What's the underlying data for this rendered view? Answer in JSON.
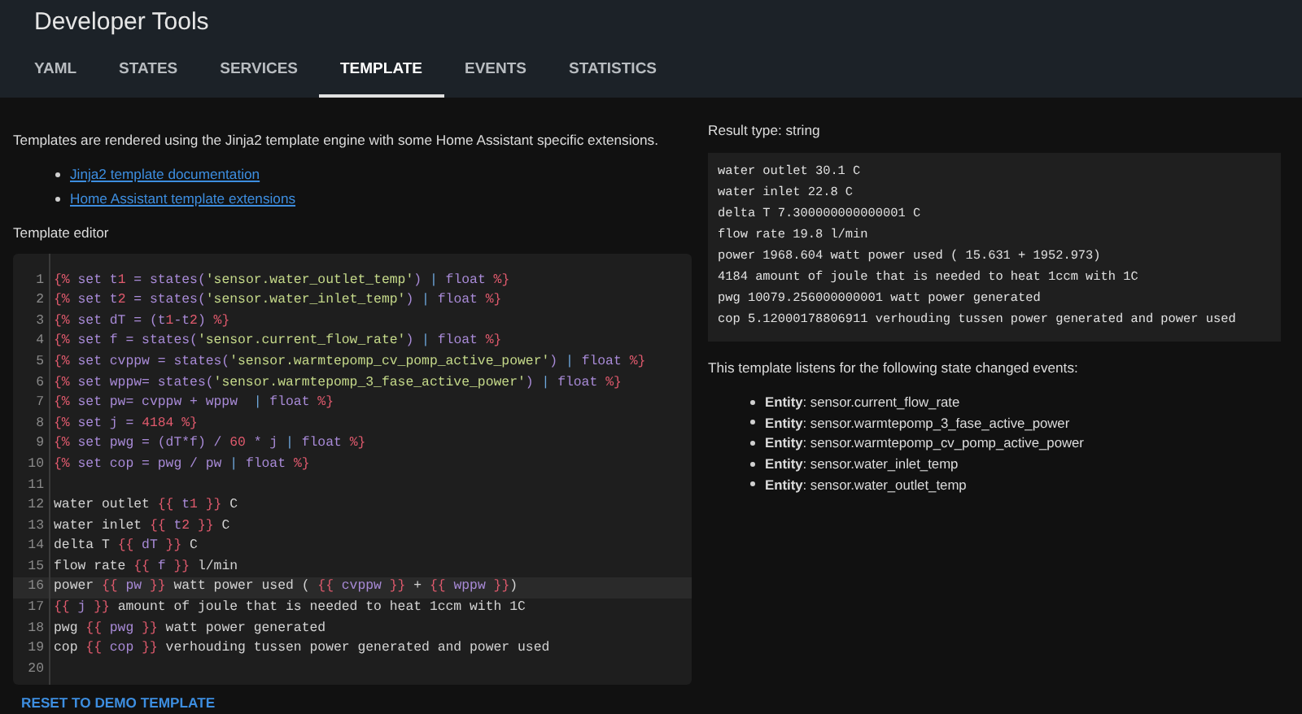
{
  "header": {
    "title": "Developer Tools"
  },
  "tabs": [
    {
      "label": "YAML",
      "selected": false
    },
    {
      "label": "STATES",
      "selected": false
    },
    {
      "label": "SERVICES",
      "selected": false
    },
    {
      "label": "TEMPLATE",
      "selected": true
    },
    {
      "label": "EVENTS",
      "selected": false
    },
    {
      "label": "STATISTICS",
      "selected": false
    }
  ],
  "intro": "Templates are rendered using the Jinja2 template engine with some Home Assistant specific extensions.",
  "links": [
    "Jinja2 template documentation",
    "Home Assistant template extensions"
  ],
  "editor": {
    "title": "Template editor",
    "lines": [
      {
        "number": "1",
        "text": "{% set t1 = states('sensor.water_outlet_temp') | float %}",
        "active": false
      },
      {
        "number": "2",
        "text": "{% set t2 = states('sensor.water_inlet_temp') | float %}",
        "active": false
      },
      {
        "number": "3",
        "text": "{% set dT = (t1-t2) %}",
        "active": false
      },
      {
        "number": "4",
        "text": "{% set f = states('sensor.current_flow_rate') | float %}",
        "active": false
      },
      {
        "number": "5",
        "text": "{% set cvppw = states('sensor.warmtepomp_cv_pomp_active_power') | float %}",
        "active": false
      },
      {
        "number": "6",
        "text": "{% set wppw= states('sensor.warmtepomp_3_fase_active_power') | float %}",
        "active": false
      },
      {
        "number": "7",
        "text": "{% set pw= cvppw + wppw  | float %}",
        "active": false
      },
      {
        "number": "8",
        "text": "{% set j = 4184 %}",
        "active": false
      },
      {
        "number": "9",
        "text": "{% set pwg = (dT*f) / 60 * j | float %}",
        "active": false
      },
      {
        "number": "10",
        "text": "{% set cop = pwg / pw | float %}",
        "active": false
      },
      {
        "number": "11",
        "active": false
      },
      {
        "number": "12",
        "text": "water outlet {{ t1 }} C",
        "active": false
      },
      {
        "number": "13",
        "text": "water inlet {{ t2 }} C",
        "active": false
      },
      {
        "number": "14",
        "text": "delta T {{ dT }} C",
        "active": false
      },
      {
        "number": "15",
        "text": "flow rate {{ f }} l/min",
        "active": false
      },
      {
        "number": "16",
        "text": "power {{ pw }} watt power used ( {{ cvppw }} + {{ wppw }})",
        "active": true
      },
      {
        "number": "17",
        "text": "{{ j }} amount of joule that is needed to heat 1ccm with 1C",
        "active": false
      },
      {
        "number": "18",
        "text": "pwg {{ pwg }} watt power generated",
        "active": false
      },
      {
        "number": "19",
        "text": "cop {{ cop }} verhouding tussen power generated and power used",
        "active": false
      },
      {
        "number": "20",
        "active": false
      }
    ]
  },
  "reset_button": "RESET TO DEMO TEMPLATE",
  "result": {
    "type_label": "Result type: string",
    "lines": [
      "water outlet 30.1 C",
      "water inlet 22.8 C",
      "delta T 7.300000000000001 C",
      "flow rate 19.8 l/min",
      "power 1968.604 watt power used ( 15.631 + 1952.973)",
      "4184 amount of joule that is needed to heat 1ccm with 1C",
      "pwg 10079.256000000001 watt power generated",
      "cop 5.12000178806911 verhouding tussen power generated and power used"
    ]
  },
  "listens": {
    "heading": "This template listens for the following state changed events:",
    "entities": [
      "**Entity**: sensor.current_flow_rate",
      "**Entity**: sensor.warmtepomp_3_fase_active_power",
      "**Entity**: sensor.warmtepomp_cv_pomp_active_power",
      "**Entity**: sensor.water_inlet_temp",
      "**Entity**: sensor.water_outlet_temp"
    ]
  }
}
